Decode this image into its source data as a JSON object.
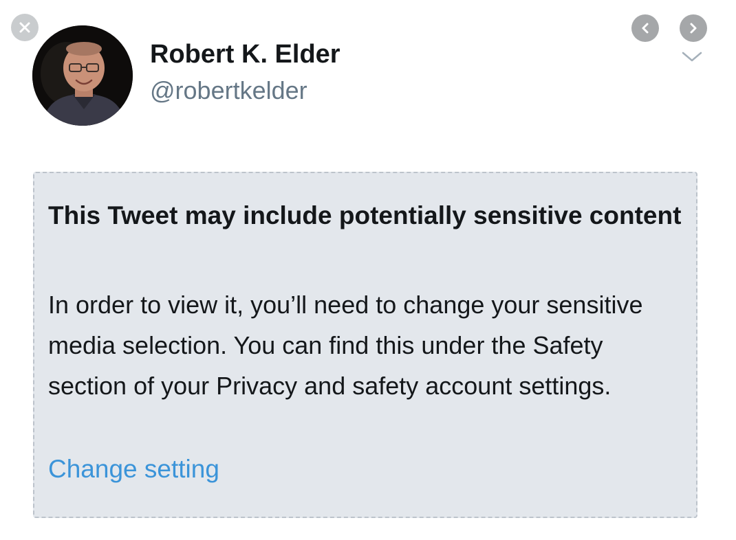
{
  "tweet": {
    "author": {
      "display_name": "Robert K. Elder",
      "handle": "@robertkelder"
    }
  },
  "controls": {
    "close_icon": "close-icon",
    "prev_icon": "chevron-left-icon",
    "next_icon": "chevron-right-icon",
    "menu_icon": "chevron-down-icon"
  },
  "sensitive_notice": {
    "title": "This Tweet may include potentially sensitive content",
    "body": "In order to view it, you’ll need to change your sensitive media selection. You can find this under the Safety section of your Privacy and safety account settings.",
    "link_label": "Change setting"
  },
  "colors": {
    "link": "#3b94d9",
    "notice_background": "#e3e7ec",
    "handle": "#657786"
  }
}
